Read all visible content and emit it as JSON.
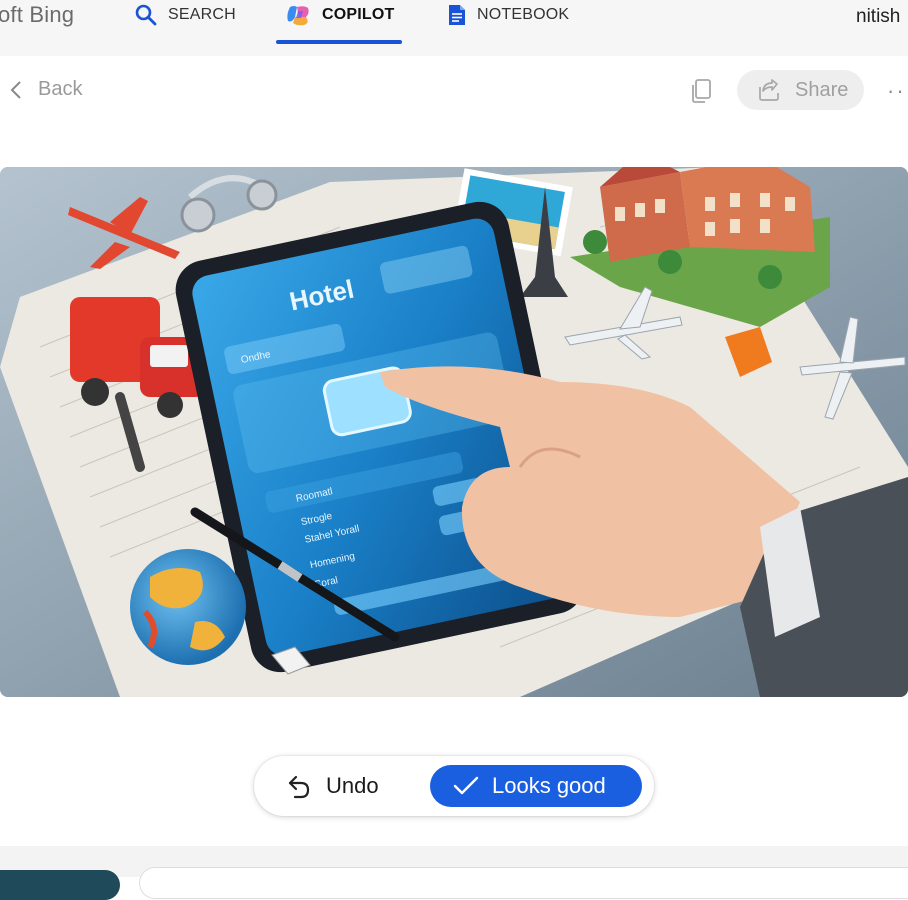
{
  "header": {
    "brand": "oft Bing",
    "tabs": [
      {
        "label": "SEARCH",
        "icon": "search-icon",
        "active": false
      },
      {
        "label": "COPILOT",
        "icon": "copilot-icon",
        "active": true
      },
      {
        "label": "NOTEBOOK",
        "icon": "notebook-icon",
        "active": false
      }
    ],
    "user": "nitish"
  },
  "actions": {
    "back_label": "Back",
    "share_label": "Share",
    "more_label": "···"
  },
  "image": {
    "screen_title": "Hotel",
    "screen_items": [
      "Ondhe",
      "Roomatl",
      "Strogle",
      "Stahel Yorall",
      "Homening",
      "Coral"
    ]
  },
  "choice": {
    "undo_label": "Undo",
    "good_label": "Looks good"
  },
  "colors": {
    "accent": "#1a54d6",
    "good_button": "#1a5fe0",
    "nav_bg": "#f6f6f6"
  }
}
